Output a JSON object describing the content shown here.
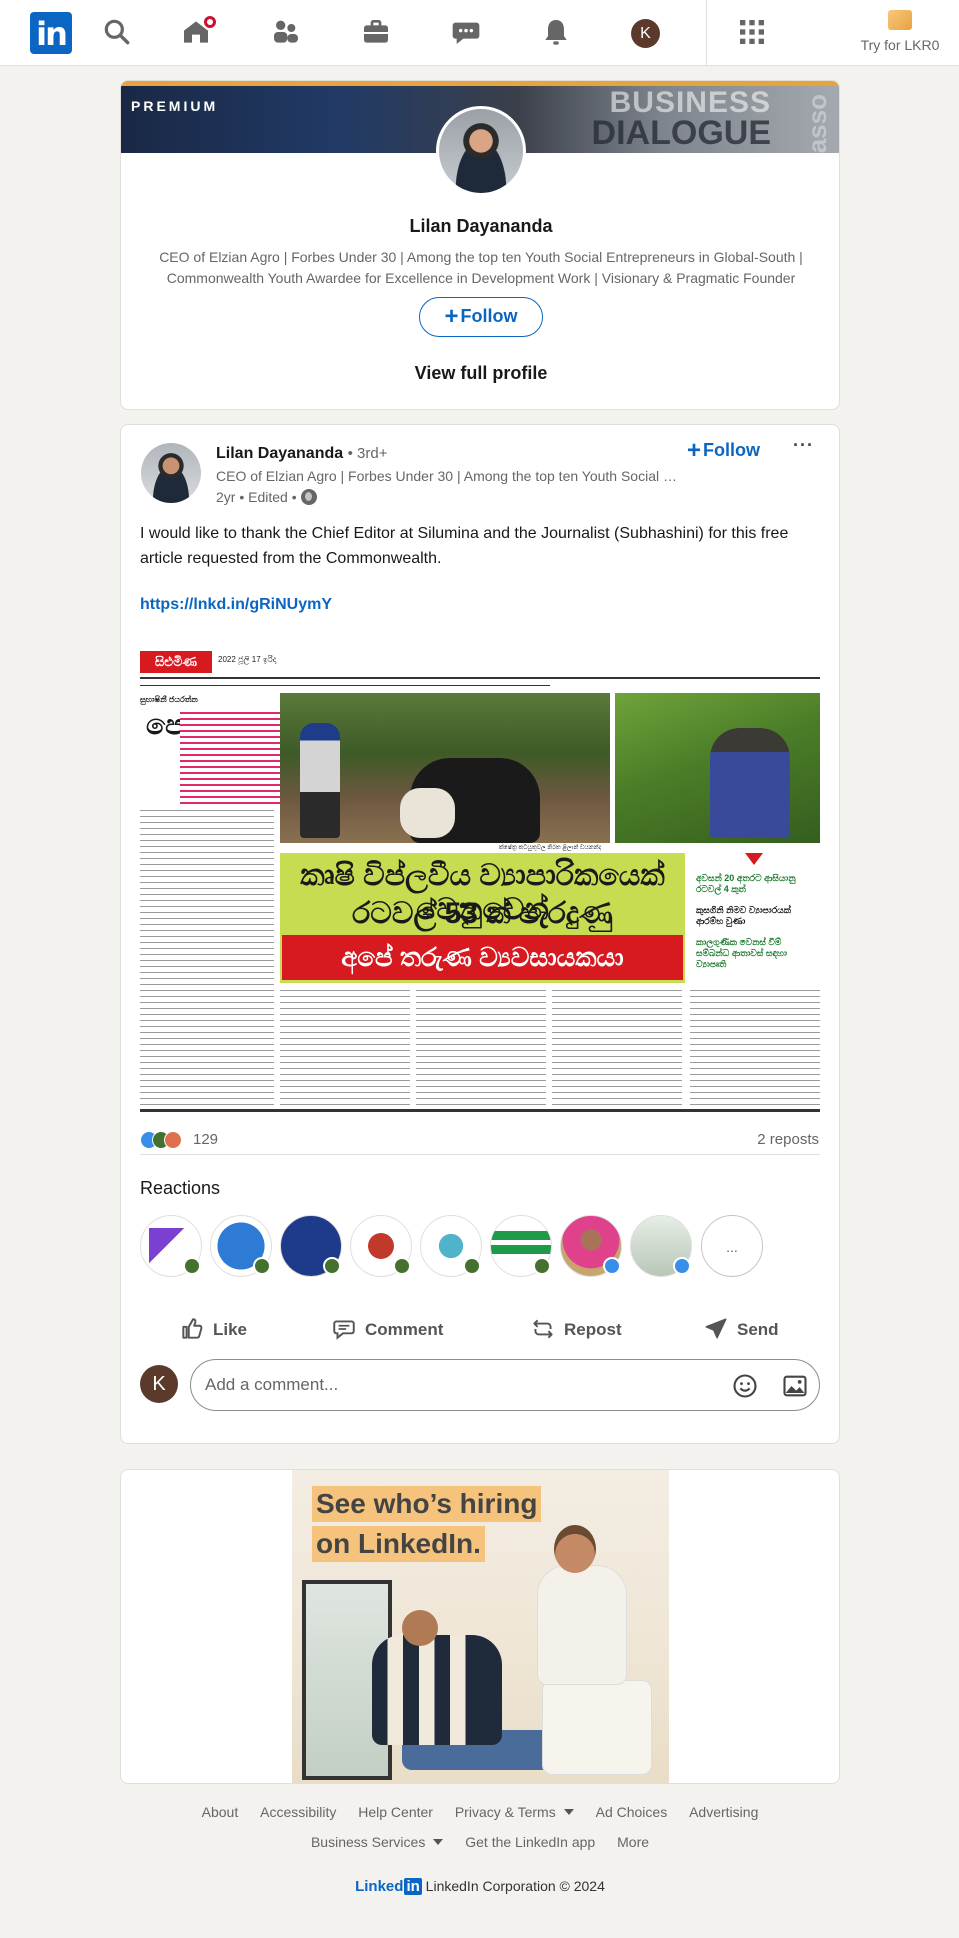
{
  "nav": {
    "logo_text": "in",
    "try_premium_label": "Try for LKR0",
    "me_initial": "K",
    "icons": [
      "search-icon",
      "home-icon",
      "my-network-icon",
      "jobs-icon",
      "messaging-icon",
      "notifications-icon",
      "work-grid-icon"
    ]
  },
  "profile_card": {
    "banner_label": "PREMIUM",
    "banner_text_line1": "BUSINESS",
    "banner_text_line2": "DIALOGUE",
    "banner_side_text": "basso",
    "name": "Lilan Dayananda",
    "headline": "CEO of Elzian Agro | Forbes Under 30 | Among the top ten Youth Social Entrepreneurs in Global-South | Commonwealth Youth Awardee for Excellence in Development Work | Visionary & Pragmatic Founder",
    "follow_label": "Follow",
    "view_profile_label": "View full profile"
  },
  "post": {
    "author": "Lilan Dayananda",
    "degree": "• 3rd+",
    "headline": "CEO of Elzian Agro | Forbes Under 30 | Among the top ten Youth Social Entrepreneurs in Global-South",
    "meta": "2yr • Edited •",
    "follow_label": "Follow",
    "more_label": "···",
    "text": "I would like to thank the Chief Editor at Silumina and the Journalist (Subhashini) for this free article requested from the Commonwealth.",
    "link": "https://lnkd.in/gRiNUymY",
    "reaction_count": "129",
    "reposts": "2 reposts",
    "reactions_title": "Reactions",
    "more_reactors_label": "...",
    "actions": {
      "like": "Like",
      "comment": "Comment",
      "repost": "Repost",
      "send": "Send"
    },
    "comment": {
      "avatar_initial": "K",
      "placeholder": "Add a comment..."
    }
  },
  "newspaper": {
    "masthead": "සිළුමිණ",
    "date_line": "2022 ජූලි 17 ඉරිදා",
    "byline": "සුභාෂිනී ජයරත්න",
    "drop_cap": "පො",
    "caption": "ක්ෂේත්‍ර කටයුතුවල නිරත ළිලාන් ඩයනන්ද",
    "headline_line1": "කෘෂි විප්ලවීය ව්‍යාපාරිකයෙක් වෙනුවෙන්",
    "headline_line2": "රටවල් 53 ක් පැරදුණු",
    "headline_red": "අපේ තරුණ ව්‍යවසායකයා",
    "side_points": [
      "අවසන් 20 අතරට ආසියානු රටවල් 4 කුත්",
      "කුසගිනි නිමව ව්‍යාපාරයක් ආරම්භ වුණා",
      "කාලගුණික වෙනස් වීම් සම්බන්ධ ආතාවස් සඳහා ව්‍යාපෘති"
    ]
  },
  "ad": {
    "headline_line1": "See who’s hiring",
    "headline_line2": "on LinkedIn."
  },
  "footer": {
    "row1": [
      "About",
      "Accessibility",
      "Help Center",
      "Privacy & Terms"
    ],
    "row1_after": [
      "Ad Choices",
      "Advertising"
    ],
    "row2": [
      "Business Services"
    ],
    "row2_after": [
      "Get the LinkedIn app",
      "More"
    ],
    "brand_word": "Linked",
    "brand_box": "in",
    "copyright": "LinkedIn Corporation © 2024"
  },
  "colors": {
    "brand": "#0a66c2",
    "background": "#f4f2ee",
    "notification": "#cb112d",
    "premium_gold": "#e7a33e"
  }
}
